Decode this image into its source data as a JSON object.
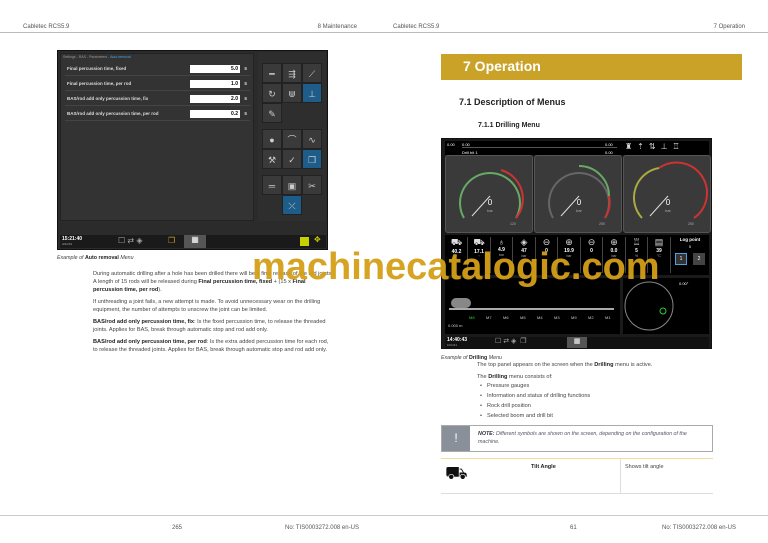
{
  "left_page": {
    "header_left": "Cabletec RCS5.9",
    "header_right": "8 Maintenance",
    "screen": {
      "breadcrumb": "Settings - RAS - Parameters - ",
      "breadcrumb_active": "Auto removal",
      "params": [
        {
          "label": "Final percussion time, fixed",
          "value": "5.0",
          "unit": "s"
        },
        {
          "label": "Final percussion time, per rod",
          "value": "1.0",
          "unit": "s"
        },
        {
          "label": "BAS/rod add only percussion time, fix",
          "value": "2.0",
          "unit": "s"
        },
        {
          "label": "BAS/rod add only percussion time, per rod",
          "value": "0.2",
          "unit": "s"
        }
      ],
      "time": "15:21:40",
      "date": "3/22/19"
    },
    "caption_pre": "Example of ",
    "caption_bold": "Auto removal",
    "caption_post": " Menu",
    "p1_a": "During automatic drilling after a hole has been drilled there will be a final release of the rod joints. A length of 15 rods will be released during ",
    "p1_b": "Final percussion time, fixed",
    "p1_c": " + (15 x ",
    "p1_d": "Final percussion time, per rod",
    "p1_e": ").",
    "p2": "If unthreading a joint fails, a new attempt is made. To avoid unnecessary wear on the drilling equipment, the number of attempts to unscrew the joint can be limited.",
    "p3_b": "BAS/rod add only percussion time, fix",
    "p3": ": Is the fixed percussion time, to release the threaded joints. Applies for BAS, break through automatic stop and rod add only.",
    "p4_b": "BAS/rod add only percussion time, per rod",
    "p4": ": Is the extra added percussion time for each rod, to release the threaded joints. Applies for BAS, break through automatic stop and rod add only.",
    "page_number": "265",
    "doc_number": "No: TIS0003272.008 en-US"
  },
  "right_page": {
    "header_left": "Cabletec RCS5.9",
    "header_right": "7 Operation",
    "chapter_title": "7 Operation",
    "section_title": "7.1  Description of Menus",
    "subsection_title": "7.1.1  Drilling Menu",
    "screen": {
      "top_left_value": "0.00",
      "bar_left": "0.00",
      "bar_right": "0.00",
      "drill_bit": "Drill bit 1",
      "bit_value": "0.00",
      "gauges": [
        {
          "value": "0",
          "unit": "bar",
          "max": "120"
        },
        {
          "value": "0",
          "unit": "bar",
          "max": "250"
        },
        {
          "value": "0",
          "unit": "bar",
          "max": "250"
        }
      ],
      "cells": [
        {
          "value": "40.2",
          "unit": "°"
        },
        {
          "value": "17.1",
          "unit": "°"
        },
        {
          "value": "4.9",
          "unit": "bar"
        },
        {
          "value": "47",
          "unit": "bar"
        },
        {
          "value": "0",
          "unit": ""
        },
        {
          "value": "19.9",
          "unit": "bar"
        },
        {
          "value": "0",
          "unit": ""
        },
        {
          "value": "0.0",
          "unit": "bar"
        },
        {
          "value": "5",
          "unit": "%"
        },
        {
          "value": "39",
          "unit": "°C"
        }
      ],
      "log_point_label": "Log point",
      "log_point_value": "0",
      "log_btn1": "1",
      "log_btn2": "2",
      "position": "0.000 m",
      "markers": [
        "M8",
        "M7",
        "M6",
        "M5",
        "M4",
        "M3",
        "M9",
        "M2",
        "M1"
      ],
      "tilt": "0.00°",
      "time": "14:40:43",
      "date": "10/1/21"
    },
    "caption_pre": "Example of ",
    "caption_bold": "Drilling",
    "caption_post": " Menu",
    "intro_a": "The top panel appears on the screen when the ",
    "intro_b": "Drilling",
    "intro_c": " menu is active.",
    "consists_a": "The ",
    "consists_b": "Drilling",
    "consists_c": " menu consists of:",
    "bullets": [
      "Pressure gauges",
      "Information and status of drilling functions",
      "Rock drill position",
      "Selected boom and drill bit"
    ],
    "note_label": "NOTE:",
    "note_text": " Different symbols are shown on the screen, depending on the configuration of the machine.",
    "table": {
      "name": "Tilt Angle",
      "description": "Shows tilt angle"
    },
    "page_number": "61",
    "doc_number": "No: TIS0003272.008 en-US"
  },
  "watermark": "machinecatalogic.com",
  "colors": {
    "banner": "#c9a227",
    "watermark": "#d4a017"
  }
}
